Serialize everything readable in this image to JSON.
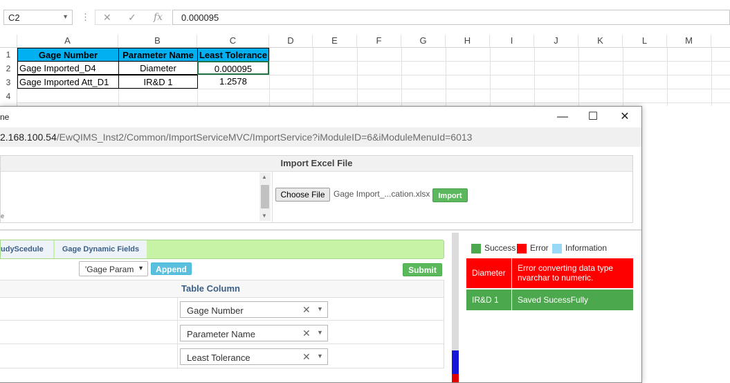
{
  "excel": {
    "name_box": "C2",
    "formula_value": "0.000095",
    "columns": [
      "A",
      "B",
      "C",
      "D",
      "E",
      "F",
      "G",
      "H",
      "I",
      "J",
      "K",
      "L",
      "M"
    ],
    "rows": [
      "1",
      "2",
      "3",
      "4"
    ],
    "headers": [
      "Gage Number",
      "Parameter Name",
      "Least Tolerance"
    ],
    "data": [
      [
        "Gage Imported_D4",
        "Diameter",
        "0.000095"
      ],
      [
        "Gage Imported Att_D1",
        "IR&D 1",
        "1.2578"
      ]
    ]
  },
  "dialog": {
    "title_fragment": "ne",
    "url_host": "2.168.100.54",
    "url_path": "/EwQIMS_Inst2/Common/ImportServiceMVC/ImportService?iModuleID=6&iModuleMenuId=6013",
    "small_fragment": "e",
    "import": {
      "title": "Import Excel File",
      "choose_label": "Choose File",
      "file_name": "Gage Import_...cation.xlsx",
      "import_label": "Import"
    },
    "tabs": [
      "udyScedule",
      "Gage Dynamic Fields"
    ],
    "param_select": "'Gage Param",
    "append_label": "Append",
    "submit_label": "Submit",
    "table_column_header": "Table Column",
    "mappings": [
      "Gage Number",
      "Parameter Name",
      "Least Tolerance"
    ],
    "clear_glyph": "✕",
    "legend": {
      "success": "Success",
      "error": "Error",
      "information": "Information"
    },
    "colors": {
      "success": "#4ca84c",
      "error": "#ff0000",
      "information": "#99d9f7"
    },
    "results": [
      {
        "param": "Diameter",
        "message": "Error converting data type nvarchar to numeric.",
        "status": "error"
      },
      {
        "param": "IR&D 1",
        "message": "Saved SucessFully",
        "status": "success"
      }
    ]
  }
}
